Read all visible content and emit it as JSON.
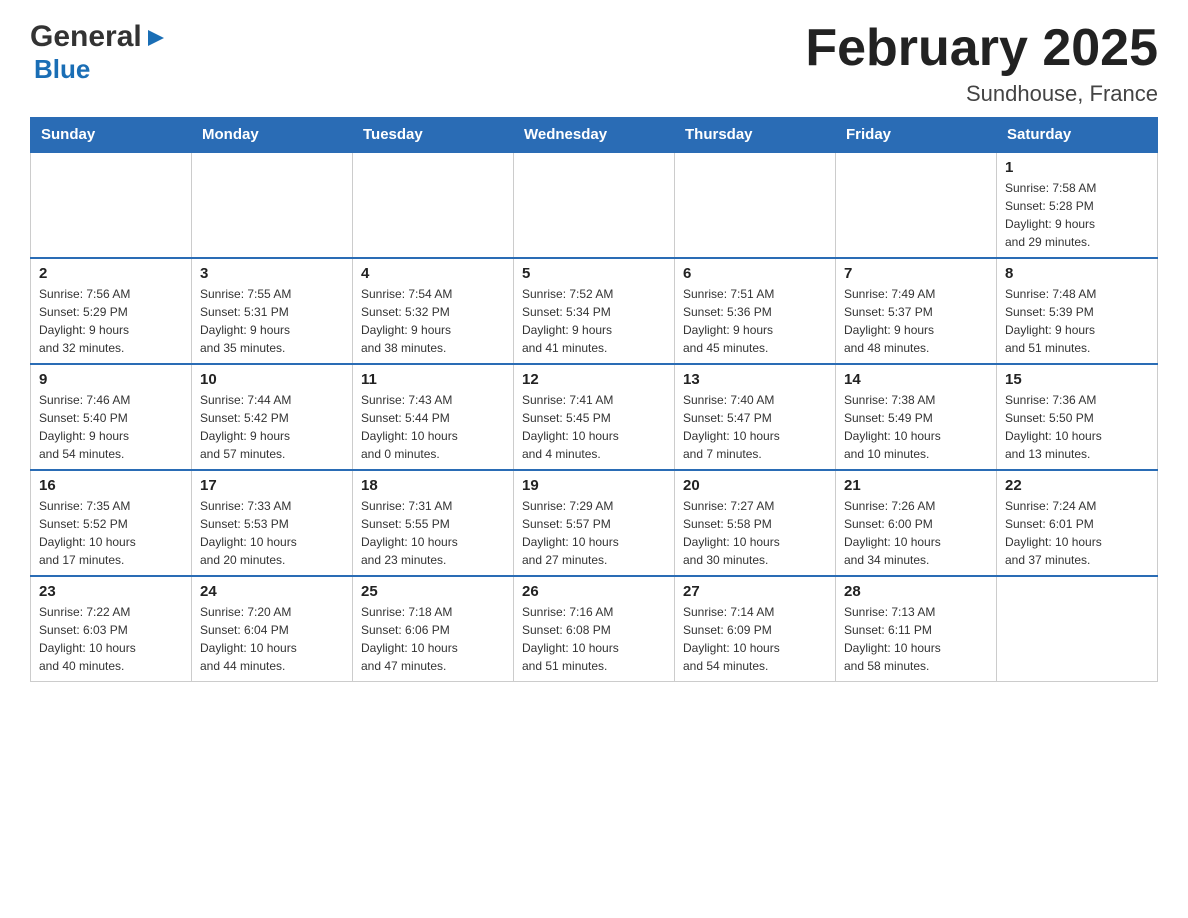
{
  "logo": {
    "line1": "General",
    "arrow": "▶",
    "line2": "Blue"
  },
  "title": "February 2025",
  "location": "Sundhouse, France",
  "weekdays": [
    "Sunday",
    "Monday",
    "Tuesday",
    "Wednesday",
    "Thursday",
    "Friday",
    "Saturday"
  ],
  "weeks": [
    [
      {
        "day": "",
        "info": ""
      },
      {
        "day": "",
        "info": ""
      },
      {
        "day": "",
        "info": ""
      },
      {
        "day": "",
        "info": ""
      },
      {
        "day": "",
        "info": ""
      },
      {
        "day": "",
        "info": ""
      },
      {
        "day": "1",
        "info": "Sunrise: 7:58 AM\nSunset: 5:28 PM\nDaylight: 9 hours\nand 29 minutes."
      }
    ],
    [
      {
        "day": "2",
        "info": "Sunrise: 7:56 AM\nSunset: 5:29 PM\nDaylight: 9 hours\nand 32 minutes."
      },
      {
        "day": "3",
        "info": "Sunrise: 7:55 AM\nSunset: 5:31 PM\nDaylight: 9 hours\nand 35 minutes."
      },
      {
        "day": "4",
        "info": "Sunrise: 7:54 AM\nSunset: 5:32 PM\nDaylight: 9 hours\nand 38 minutes."
      },
      {
        "day": "5",
        "info": "Sunrise: 7:52 AM\nSunset: 5:34 PM\nDaylight: 9 hours\nand 41 minutes."
      },
      {
        "day": "6",
        "info": "Sunrise: 7:51 AM\nSunset: 5:36 PM\nDaylight: 9 hours\nand 45 minutes."
      },
      {
        "day": "7",
        "info": "Sunrise: 7:49 AM\nSunset: 5:37 PM\nDaylight: 9 hours\nand 48 minutes."
      },
      {
        "day": "8",
        "info": "Sunrise: 7:48 AM\nSunset: 5:39 PM\nDaylight: 9 hours\nand 51 minutes."
      }
    ],
    [
      {
        "day": "9",
        "info": "Sunrise: 7:46 AM\nSunset: 5:40 PM\nDaylight: 9 hours\nand 54 minutes."
      },
      {
        "day": "10",
        "info": "Sunrise: 7:44 AM\nSunset: 5:42 PM\nDaylight: 9 hours\nand 57 minutes."
      },
      {
        "day": "11",
        "info": "Sunrise: 7:43 AM\nSunset: 5:44 PM\nDaylight: 10 hours\nand 0 minutes."
      },
      {
        "day": "12",
        "info": "Sunrise: 7:41 AM\nSunset: 5:45 PM\nDaylight: 10 hours\nand 4 minutes."
      },
      {
        "day": "13",
        "info": "Sunrise: 7:40 AM\nSunset: 5:47 PM\nDaylight: 10 hours\nand 7 minutes."
      },
      {
        "day": "14",
        "info": "Sunrise: 7:38 AM\nSunset: 5:49 PM\nDaylight: 10 hours\nand 10 minutes."
      },
      {
        "day": "15",
        "info": "Sunrise: 7:36 AM\nSunset: 5:50 PM\nDaylight: 10 hours\nand 13 minutes."
      }
    ],
    [
      {
        "day": "16",
        "info": "Sunrise: 7:35 AM\nSunset: 5:52 PM\nDaylight: 10 hours\nand 17 minutes."
      },
      {
        "day": "17",
        "info": "Sunrise: 7:33 AM\nSunset: 5:53 PM\nDaylight: 10 hours\nand 20 minutes."
      },
      {
        "day": "18",
        "info": "Sunrise: 7:31 AM\nSunset: 5:55 PM\nDaylight: 10 hours\nand 23 minutes."
      },
      {
        "day": "19",
        "info": "Sunrise: 7:29 AM\nSunset: 5:57 PM\nDaylight: 10 hours\nand 27 minutes."
      },
      {
        "day": "20",
        "info": "Sunrise: 7:27 AM\nSunset: 5:58 PM\nDaylight: 10 hours\nand 30 minutes."
      },
      {
        "day": "21",
        "info": "Sunrise: 7:26 AM\nSunset: 6:00 PM\nDaylight: 10 hours\nand 34 minutes."
      },
      {
        "day": "22",
        "info": "Sunrise: 7:24 AM\nSunset: 6:01 PM\nDaylight: 10 hours\nand 37 minutes."
      }
    ],
    [
      {
        "day": "23",
        "info": "Sunrise: 7:22 AM\nSunset: 6:03 PM\nDaylight: 10 hours\nand 40 minutes."
      },
      {
        "day": "24",
        "info": "Sunrise: 7:20 AM\nSunset: 6:04 PM\nDaylight: 10 hours\nand 44 minutes."
      },
      {
        "day": "25",
        "info": "Sunrise: 7:18 AM\nSunset: 6:06 PM\nDaylight: 10 hours\nand 47 minutes."
      },
      {
        "day": "26",
        "info": "Sunrise: 7:16 AM\nSunset: 6:08 PM\nDaylight: 10 hours\nand 51 minutes."
      },
      {
        "day": "27",
        "info": "Sunrise: 7:14 AM\nSunset: 6:09 PM\nDaylight: 10 hours\nand 54 minutes."
      },
      {
        "day": "28",
        "info": "Sunrise: 7:13 AM\nSunset: 6:11 PM\nDaylight: 10 hours\nand 58 minutes."
      },
      {
        "day": "",
        "info": ""
      }
    ]
  ]
}
